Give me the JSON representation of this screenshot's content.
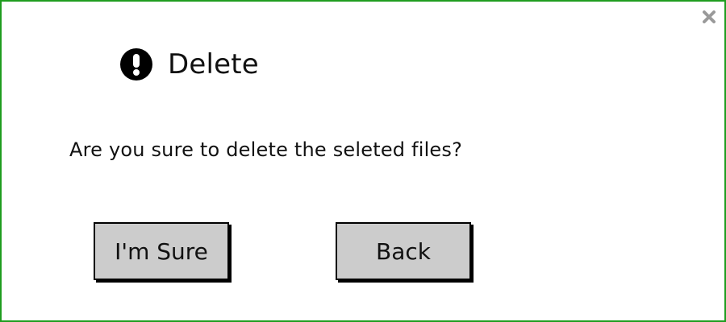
{
  "dialog": {
    "title": "Delete",
    "message": "Are you sure to delete the seleted files?",
    "icons": {
      "title_icon": "exclamation-circle-icon",
      "close_icon": "close-icon"
    },
    "buttons": {
      "confirm_label": "I'm Sure",
      "back_label": "Back"
    },
    "colors": {
      "border": "#1f9d1f",
      "button_bg": "#cccccc",
      "text": "#111111",
      "close_icon": "#9a9a9a"
    }
  }
}
